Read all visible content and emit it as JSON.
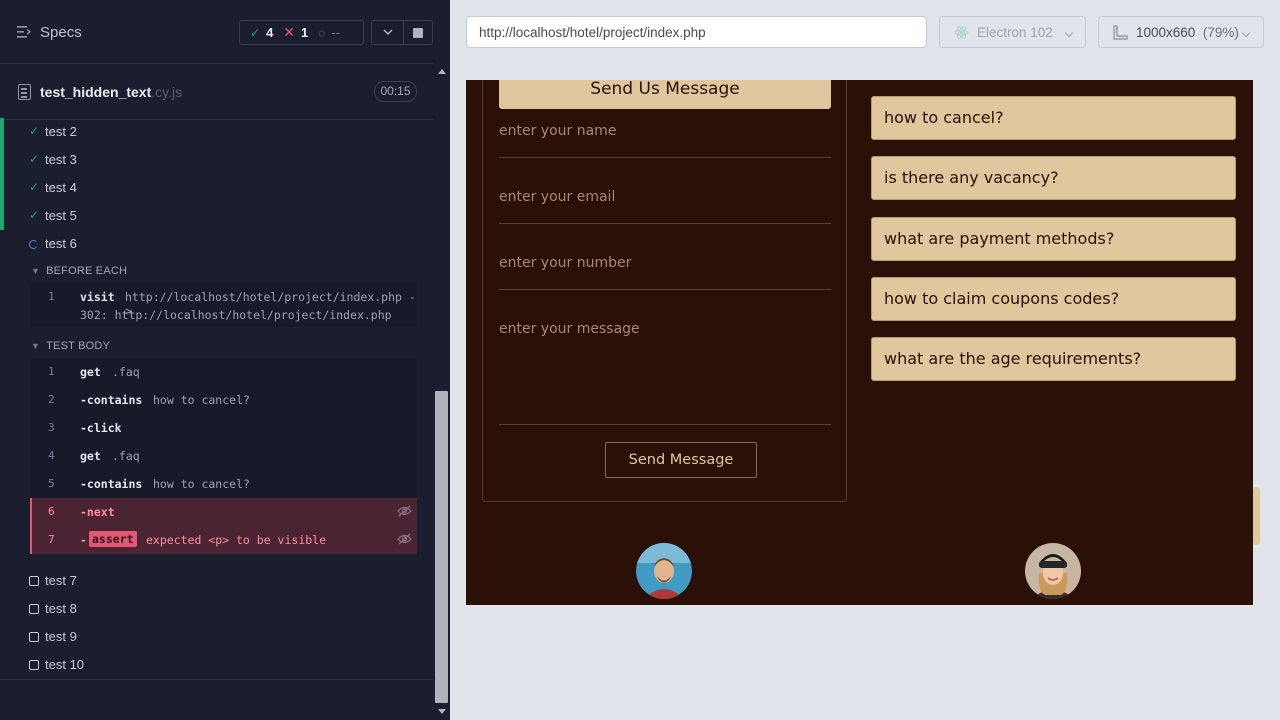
{
  "reporter": {
    "specs_label": "Specs",
    "stats": {
      "passed": "4",
      "failed": "1",
      "pending": "--"
    },
    "spec": {
      "name": "test_hidden_text",
      "ext": ".cy.js",
      "duration": "00:15"
    },
    "passed_tests": [
      "test 2",
      "test 3",
      "test 4",
      "test 5"
    ],
    "running_test": "test 6",
    "before_each": {
      "title": "BEFORE EACH",
      "commands": [
        {
          "n": "1",
          "name": "visit",
          "arg": "http://localhost/hotel/project/index.php ->",
          "arg2": "302: http://localhost/hotel/project/index.php"
        }
      ]
    },
    "test_body": {
      "title": "TEST BODY",
      "commands": [
        {
          "n": "1",
          "name": "get",
          "arg": ".faq"
        },
        {
          "n": "2",
          "name": "-contains",
          "arg": "how to cancel?"
        },
        {
          "n": "3",
          "name": "-click",
          "arg": ""
        },
        {
          "n": "4",
          "name": "get",
          "arg": ".faq"
        },
        {
          "n": "5",
          "name": "-contains",
          "arg": "how to cancel?"
        },
        {
          "n": "6",
          "name": "-next",
          "arg": ""
        },
        {
          "n": "7",
          "name": "-",
          "badge": "assert",
          "arg": "expected <p> to be visible"
        }
      ]
    },
    "pending_tests": [
      "test 7",
      "test 8",
      "test 9",
      "test 10"
    ]
  },
  "aut": {
    "url": "http://localhost/hotel/project/index.php",
    "browser": "Electron 102",
    "viewport": "1000x660",
    "scale": "(79%)"
  },
  "app": {
    "contact": {
      "title": "Send Us Message",
      "name_placeholder": "enter your name",
      "email_placeholder": "enter your email",
      "number_placeholder": "enter your number",
      "message_placeholder": "enter your message",
      "send_label": "Send Message"
    },
    "faqs": [
      "how to cancel?",
      "is there any vacancy?",
      "what are payment methods?",
      "how to claim coupons codes?",
      "what are the age requirements?"
    ]
  },
  "colors": {
    "pass": "#1fa971",
    "fail": "#e45770",
    "app_bg": "#2b1007",
    "accent": "#dfc89d"
  }
}
